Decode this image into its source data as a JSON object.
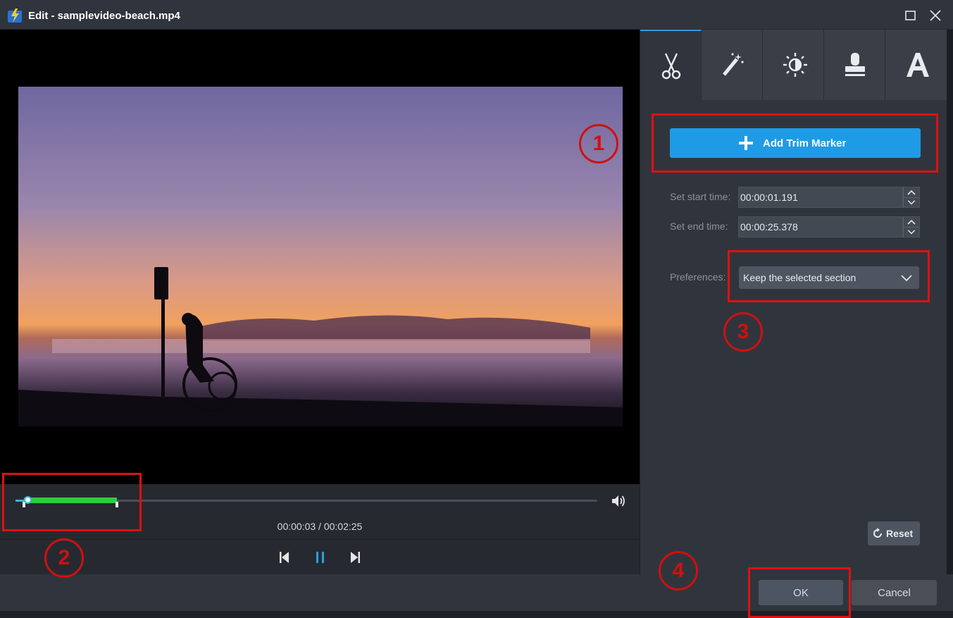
{
  "window": {
    "title": "Edit - samplevideo-beach.mp4"
  },
  "player": {
    "timecode": "00:00:03 / 00:02:25",
    "progress_fraction": 0.02,
    "selection_start_fraction": 0.015,
    "selection_end_fraction": 0.174
  },
  "tabs": [
    {
      "name": "trim",
      "icon": "scissors-icon",
      "active": true
    },
    {
      "name": "effects",
      "icon": "magic-wand-icon",
      "active": false
    },
    {
      "name": "adjust",
      "icon": "brightness-icon",
      "active": false
    },
    {
      "name": "watermark",
      "icon": "stamp-icon",
      "active": false
    },
    {
      "name": "text",
      "icon": "text-icon",
      "active": false
    }
  ],
  "trim": {
    "add_marker_label": "Add Trim Marker",
    "start_label": "Set start time:",
    "start_value": "00:00:01.191",
    "end_label": "Set end time:",
    "end_value": "00:00:25.378",
    "preferences_label": "Preferences:",
    "preferences_value": "Keep the selected section",
    "reset_label": "Reset"
  },
  "footer": {
    "ok_label": "OK",
    "cancel_label": "Cancel"
  },
  "annotations": {
    "n1": "1",
    "n2": "2",
    "n3": "3",
    "n4": "4"
  },
  "colors": {
    "accent": "#1f9be6",
    "selection": "#2ecc40",
    "annotation": "#e01010"
  }
}
